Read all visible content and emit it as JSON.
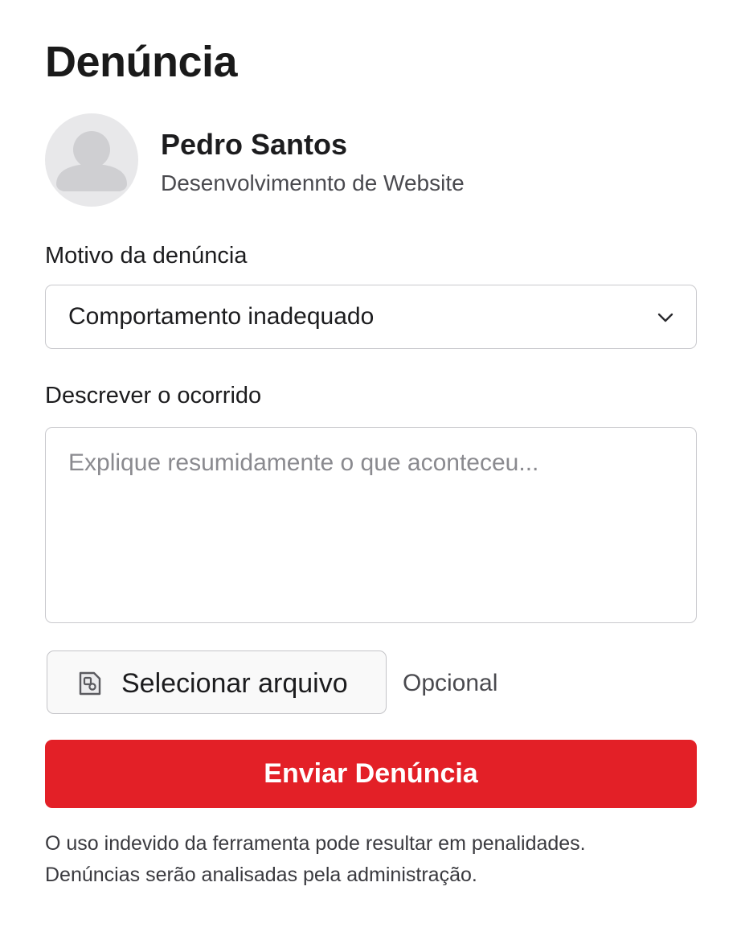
{
  "header": {
    "title": "Denúncia"
  },
  "profile": {
    "avatar_icon": "person-silhouette-icon",
    "name": "Pedro Santos",
    "role": "Desenvolvimennto de Website"
  },
  "reason": {
    "label": "Motivo da denúncia",
    "selected": "Comportamento inadequado",
    "icon": "chevron-down-icon"
  },
  "description": {
    "label": "Descrever o ocorrido",
    "value": "",
    "placeholder": "Explique resumidamente o que aconteceu..."
  },
  "attachment": {
    "button_label": "Selecionar arquivo",
    "icon": "file-image-icon",
    "hint": "Opcional"
  },
  "submit": {
    "label": "Enviar Denúncia",
    "color": "#e32027"
  },
  "footnote": {
    "line1": "O uso indevido da ferramenta pode resultar em penalidades.",
    "line2": "Denúncias serão analisadas pela administração."
  }
}
